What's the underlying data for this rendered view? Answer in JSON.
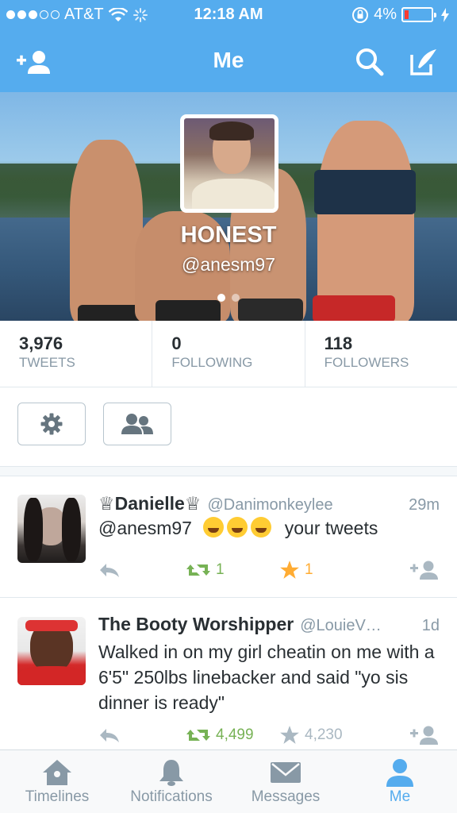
{
  "status_bar": {
    "carrier": "AT&T",
    "time": "12:18 AM",
    "battery": "4%"
  },
  "nav": {
    "title": "Me"
  },
  "profile": {
    "name": "HONEST",
    "handle": "@anesm97"
  },
  "stats": [
    {
      "value": "3,976",
      "label": "TWEETS"
    },
    {
      "value": "0",
      "label": "FOLLOWING"
    },
    {
      "value": "118",
      "label": "FOLLOWERS"
    }
  ],
  "tweets": [
    {
      "name": "♕Danielle♕",
      "screen_name": "@Danimonkeylee",
      "time": "29m",
      "mention": "@anesm97",
      "text_after_emoji": "your tweets",
      "retweets": "1",
      "favorites": "1"
    },
    {
      "name": "The Booty Worshipper",
      "screen_name": "@LouieV…",
      "time": "1d",
      "text": "Walked in on my girl cheatin on me with a 6'5\" 250lbs linebacker and said \"yo sis dinner is ready\"",
      "retweets": "4,499",
      "favorites": "4,230"
    }
  ],
  "tabs": [
    {
      "label": "Timelines",
      "icon": "home-icon"
    },
    {
      "label": "Notifications",
      "icon": "bell-icon"
    },
    {
      "label": "Messages",
      "icon": "envelope-icon"
    },
    {
      "label": "Me",
      "icon": "person-icon"
    }
  ],
  "colors": {
    "brand": "#55acee",
    "retweet": "#77b255",
    "favorite": "#ffac33",
    "muted": "#8899a6"
  }
}
